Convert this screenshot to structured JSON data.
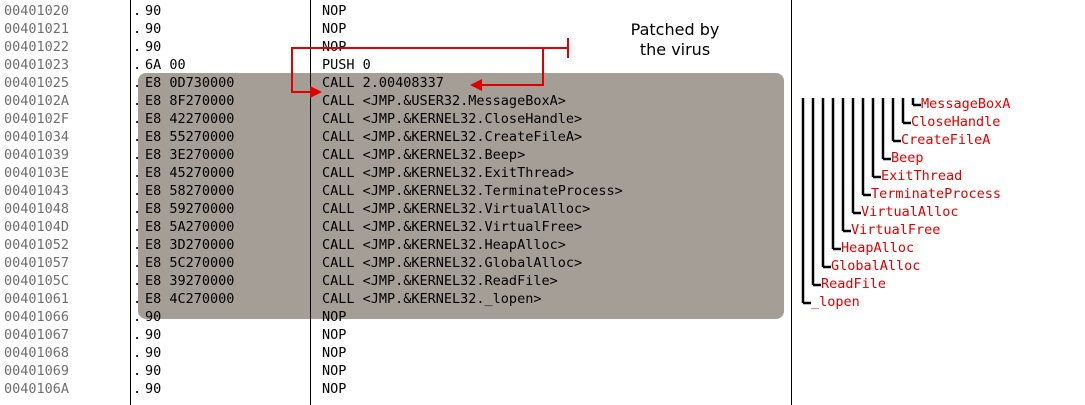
{
  "listing": [
    {
      "addr": "00401020",
      "dot": ".",
      "hex": "90",
      "instr": "NOP"
    },
    {
      "addr": "00401021",
      "dot": ".",
      "hex": "90",
      "instr": "NOP"
    },
    {
      "addr": "00401022",
      "dot": ".",
      "hex": "90",
      "instr": "NOP"
    },
    {
      "addr": "00401023",
      "dot": ".",
      "hex": "6A 00",
      "instr": "PUSH 0"
    },
    {
      "addr": "00401025",
      "dot": ".",
      "hex": "E8 0D730000",
      "instr": "CALL 2.00408337"
    },
    {
      "addr": "0040102A",
      "dot": ".",
      "hex": "E8 8F270000",
      "instr": "CALL <JMP.&USER32.MessageBoxA>"
    },
    {
      "addr": "0040102F",
      "dot": ".",
      "hex": "E8 42270000",
      "instr": "CALL <JMP.&KERNEL32.CloseHandle>"
    },
    {
      "addr": "00401034",
      "dot": ".",
      "hex": "E8 55270000",
      "instr": "CALL <JMP.&KERNEL32.CreateFileA>"
    },
    {
      "addr": "00401039",
      "dot": ".",
      "hex": "E8 3E270000",
      "instr": "CALL <JMP.&KERNEL32.Beep>"
    },
    {
      "addr": "0040103E",
      "dot": ".",
      "hex": "E8 45270000",
      "instr": "CALL <JMP.&KERNEL32.ExitThread>"
    },
    {
      "addr": "00401043",
      "dot": ".",
      "hex": "E8 58270000",
      "instr": "CALL <JMP.&KERNEL32.TerminateProcess>"
    },
    {
      "addr": "00401048",
      "dot": ".",
      "hex": "E8 59270000",
      "instr": "CALL <JMP.&KERNEL32.VirtualAlloc>"
    },
    {
      "addr": "0040104D",
      "dot": ".",
      "hex": "E8 5A270000",
      "instr": "CALL <JMP.&KERNEL32.VirtualFree>"
    },
    {
      "addr": "00401052",
      "dot": ".",
      "hex": "E8 3D270000",
      "instr": "CALL <JMP.&KERNEL32.HeapAlloc>"
    },
    {
      "addr": "00401057",
      "dot": ".",
      "hex": "E8 5C270000",
      "instr": "CALL <JMP.&KERNEL32.GlobalAlloc>"
    },
    {
      "addr": "0040105C",
      "dot": ".",
      "hex": "E8 39270000",
      "instr": "CALL <JMP.&KERNEL32.ReadFile>"
    },
    {
      "addr": "00401061",
      "dot": ".",
      "hex": "E8 4C270000",
      "instr": "CALL <JMP.&KERNEL32._lopen>"
    },
    {
      "addr": "00401066",
      "dot": ".",
      "hex": "90",
      "instr": "NOP"
    },
    {
      "addr": "00401067",
      "dot": ".",
      "hex": "90",
      "instr": "NOP"
    },
    {
      "addr": "00401068",
      "dot": ".",
      "hex": "90",
      "instr": "NOP"
    },
    {
      "addr": "00401069",
      "dot": ".",
      "hex": "90",
      "instr": "NOP"
    },
    {
      "addr": "0040106A",
      "dot": ".",
      "hex": "90",
      "instr": "NOP"
    }
  ],
  "note": {
    "line1": "Patched by",
    "line2": "the virus"
  },
  "api_tree": [
    "MessageBoxA",
    "CloseHandle",
    "CreateFileA",
    "Beep",
    "ExitThread",
    "TerminateProcess",
    "VirtualAlloc",
    "VirtualFree",
    "HeapAlloc",
    "GlobalAlloc",
    "ReadFile",
    "_lopen"
  ],
  "colors": {
    "address_text": "#6e6e6e",
    "highlight": "#a59e97",
    "arrow": "#e00000",
    "tree_label": "#e00000"
  }
}
